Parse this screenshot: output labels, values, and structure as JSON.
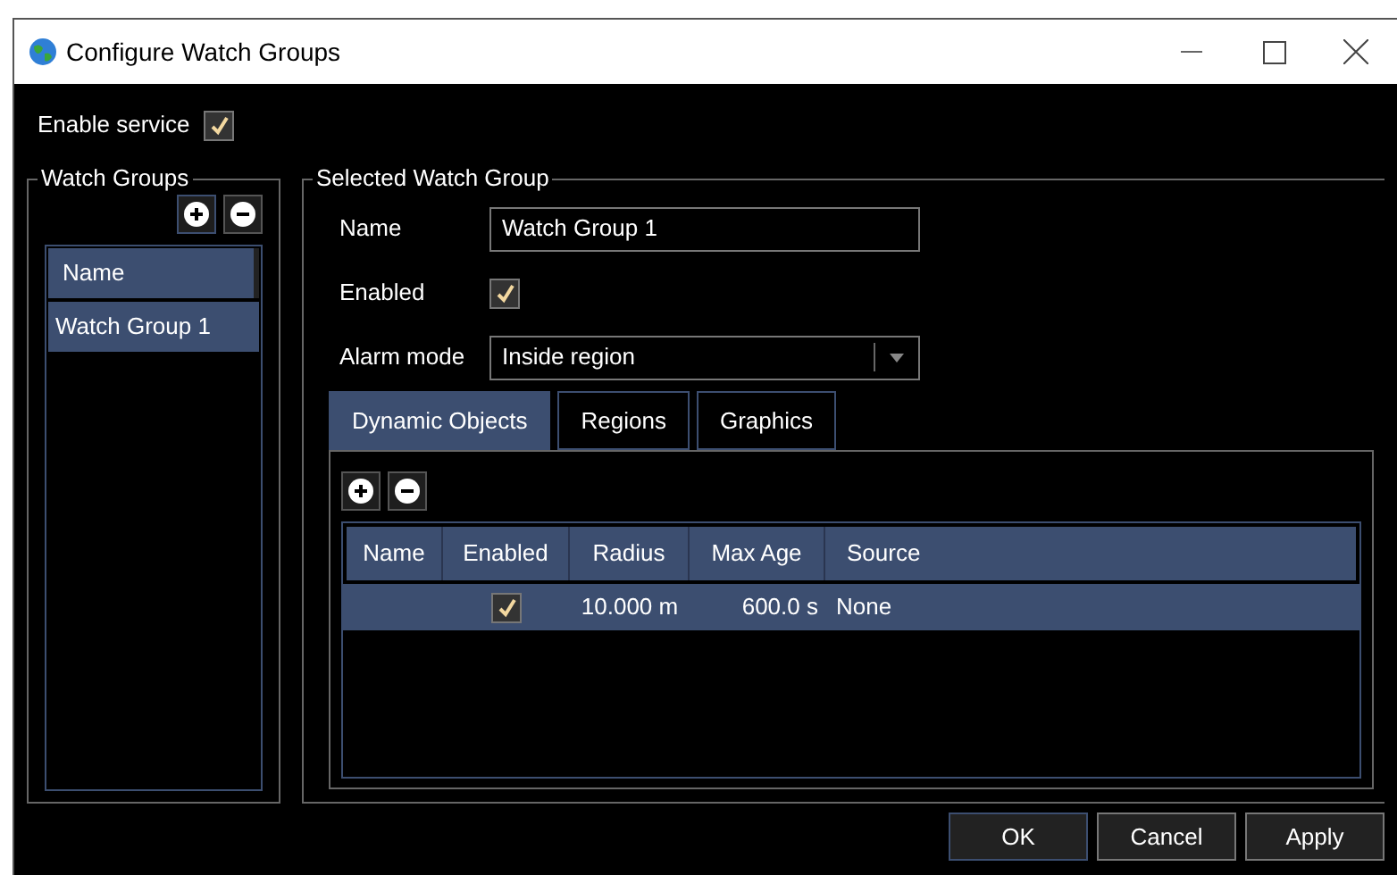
{
  "window": {
    "title": "Configure Watch Groups"
  },
  "enable_service": {
    "label": "Enable service",
    "checked": true
  },
  "watch_groups": {
    "title": "Watch Groups",
    "column": "Name",
    "rows": [
      {
        "name": "Watch Group 1",
        "selected": true
      }
    ]
  },
  "selected_group": {
    "title": "Selected Watch Group",
    "name": {
      "label": "Name",
      "value": "Watch Group 1"
    },
    "enabled": {
      "label": "Enabled",
      "checked": true
    },
    "alarm_mode": {
      "label": "Alarm mode",
      "value": "Inside region"
    },
    "tabs": [
      {
        "label": "Dynamic Objects",
        "selected": true
      },
      {
        "label": "Regions",
        "selected": false
      },
      {
        "label": "Graphics",
        "selected": false
      }
    ],
    "table": {
      "columns": [
        "Name",
        "Enabled",
        "Radius",
        "Max Age",
        "Source"
      ],
      "rows": [
        {
          "name": "",
          "enabled": true,
          "radius": "10.000 m",
          "max_age": "600.0 s",
          "source": "None",
          "selected": true
        }
      ]
    }
  },
  "buttons": [
    {
      "label": "OK",
      "default": true
    },
    {
      "label": "Cancel",
      "default": false
    },
    {
      "label": "Apply",
      "default": false
    }
  ]
}
